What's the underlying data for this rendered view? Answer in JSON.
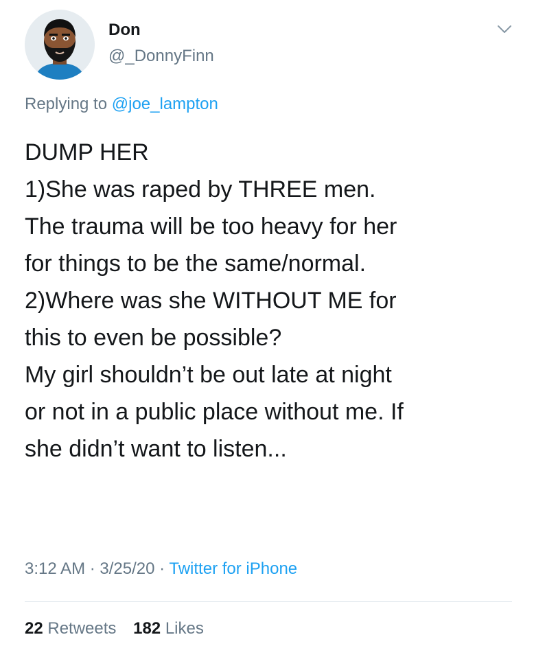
{
  "tweet": {
    "author": {
      "display_name": "Don",
      "handle": "@_DonnyFinn",
      "avatar_icon": "bearded-man-avatar-icon"
    },
    "menu_icon": "chevron-down-icon",
    "reply_prefix": "Replying to",
    "reply_to": "@joe_lampton",
    "body_lines": [
      "DUMP HER",
      "1)She was raped by THREE men.",
      "The trauma will be too heavy for her",
      "for things to be the same/normal.",
      "2)Where was she WITHOUT ME for",
      "this to even be possible?",
      "My girl shouldn’t be out late at night",
      "or not in a public place without me. If",
      "she didn’t want to listen..."
    ],
    "time": "3:12 AM",
    "date": "3/25/20",
    "separator": "·",
    "source": "Twitter for iPhone",
    "retweets_count": "22",
    "retweets_label": "Retweets",
    "likes_count": "182",
    "likes_label": "Likes"
  },
  "colors": {
    "text_primary": "#14171a",
    "text_secondary": "#657786",
    "link": "#1da1f2",
    "divider": "#e1e8ed"
  }
}
